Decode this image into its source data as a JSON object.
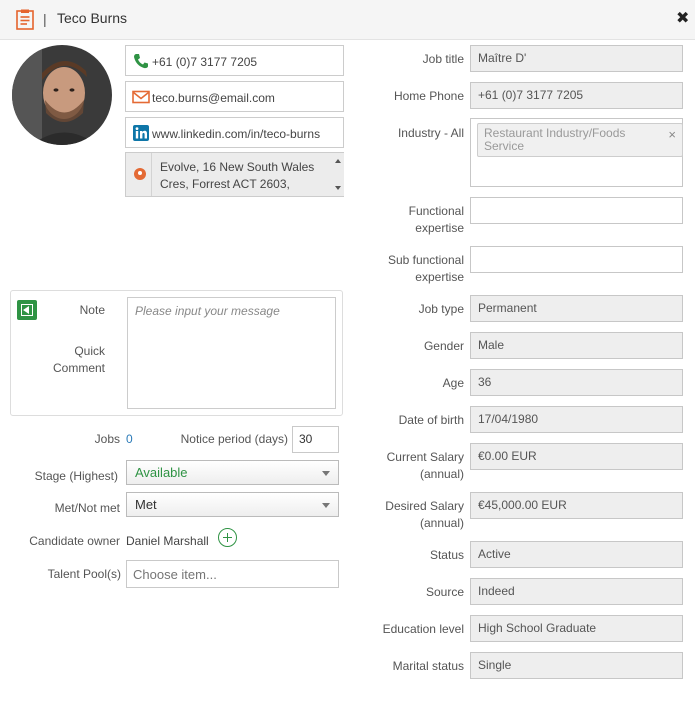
{
  "header": {
    "separator": "|",
    "title": "Teco Burns"
  },
  "contact": {
    "phone": "+61 (0)7 3177 7205",
    "email": "teco.burns@email.com",
    "linkedin": "www.linkedin.com/in/teco-burns",
    "address": "Evolve, 16 New South Wales Cres, Forrest ACT 2603,"
  },
  "note": {
    "tab_note": "Note",
    "tab_quick_comment": "Quick Comment",
    "placeholder": "Please input your message"
  },
  "left_fields": {
    "jobs_label": "Jobs",
    "jobs_value": "0",
    "notice_label": "Notice period (days)",
    "notice_value": "30",
    "stage_label": "Stage (Highest)",
    "stage_value": "Available",
    "met_label": "Met/Not met",
    "met_value": "Met",
    "owner_label": "Candidate owner",
    "owner_value": "Daniel Marshall",
    "talent_label": "Talent Pool(s)",
    "talent_placeholder": "Choose item..."
  },
  "right_fields": {
    "job_title": {
      "label": "Job title",
      "value": "Maître D'"
    },
    "home_phone": {
      "label": "Home Phone",
      "value": "+61 (0)7 3177 7205"
    },
    "industry": {
      "label": "Industry - All",
      "value": "Restaurant Industry/Foods Service"
    },
    "functional": {
      "label": "Functional expertise",
      "value": ""
    },
    "sub_functional": {
      "label": "Sub functional expertise",
      "value": ""
    },
    "job_type": {
      "label": "Job type",
      "value": "Permanent"
    },
    "gender": {
      "label": "Gender",
      "value": "Male"
    },
    "age": {
      "label": "Age",
      "value": "36"
    },
    "dob": {
      "label": "Date of birth",
      "value": "17/04/1980"
    },
    "current_salary": {
      "label": "Current Salary (annual)",
      "value": "€0.00 EUR"
    },
    "desired_salary": {
      "label": "Desired Salary (annual)",
      "value": "€45,000.00 EUR"
    },
    "status": {
      "label": "Status",
      "value": "Active"
    },
    "source": {
      "label": "Source",
      "value": "Indeed"
    },
    "education": {
      "label": "Education level",
      "value": "High School Graduate"
    },
    "marital": {
      "label": "Marital status",
      "value": "Single"
    }
  },
  "colors": {
    "accent_green": "#2f9344",
    "available_text": "#2f9344",
    "linkedin_blue": "#0e76a8",
    "email_orange": "#e46a35",
    "doc_icon_orange": "#e5642d"
  },
  "icons": {
    "header": "document-icon",
    "phone": "phone-icon",
    "email": "envelope-icon",
    "linkedin": "linkedin-icon",
    "address": "map-pin-icon",
    "close": "close-icon",
    "owner_add": "plus-circle-icon",
    "note_back": "back-arrow-icon"
  }
}
